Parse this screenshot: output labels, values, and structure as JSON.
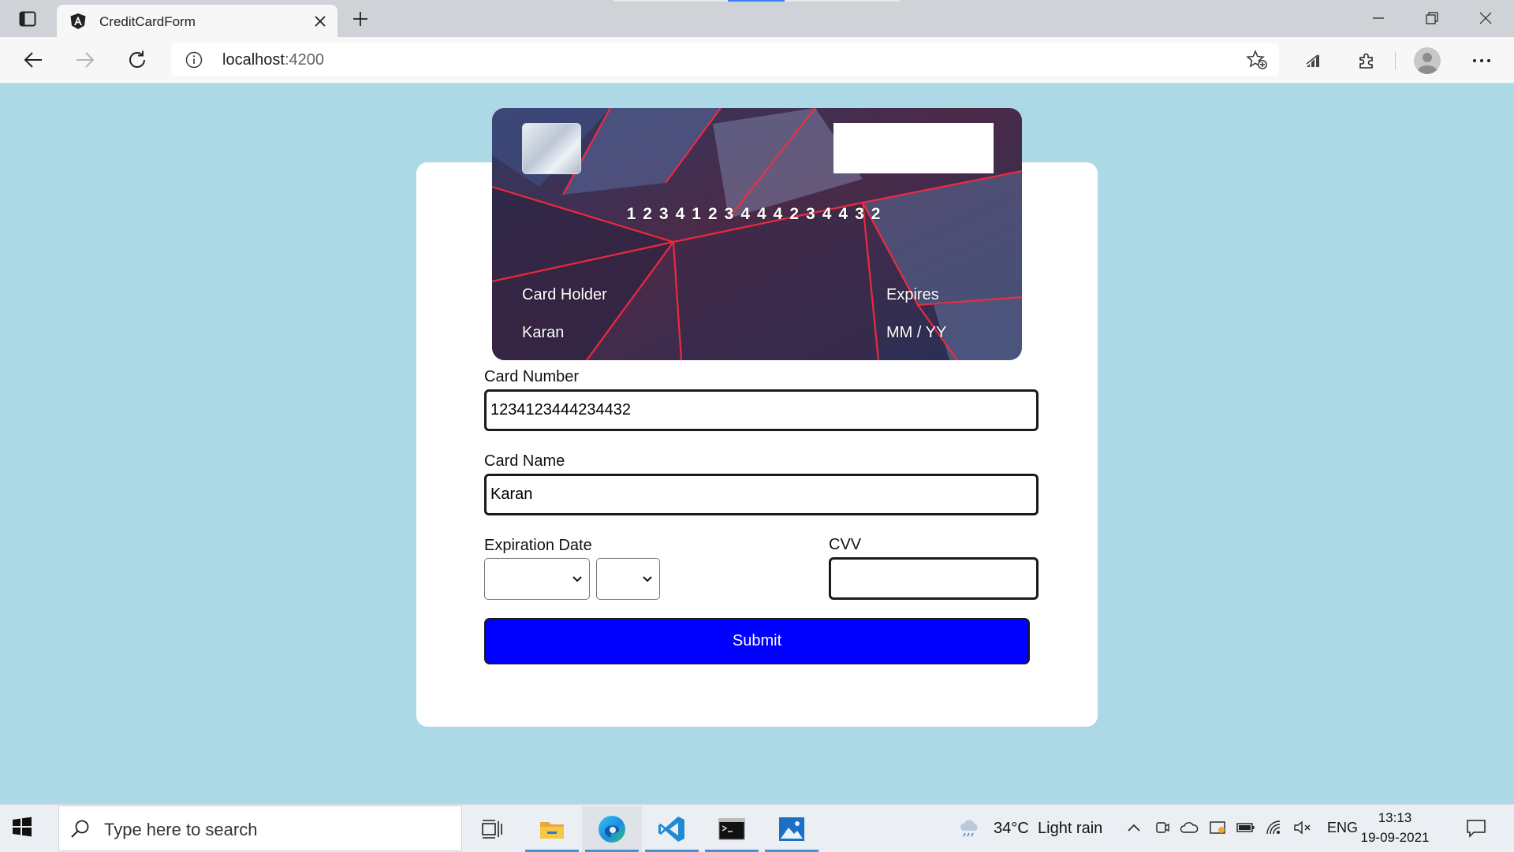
{
  "browser": {
    "tab_title": "CreditCardForm",
    "url_host": "localhost",
    "url_port": ":4200"
  },
  "card_preview": {
    "number": "1234123444234432",
    "holder_label": "Card Holder",
    "holder_name": "Karan",
    "expires_label": "Expires",
    "expires_value": "MM / YY"
  },
  "form": {
    "card_number_label": "Card Number",
    "card_number_value": "1234123444234432",
    "card_name_label": "Card Name",
    "card_name_value": "Karan",
    "expiration_label": "Expiration Date",
    "cvv_label": "CVV",
    "cvv_value": "",
    "submit_label": "Submit"
  },
  "taskbar": {
    "search_placeholder": "Type here to search",
    "weather": "34°C",
    "weather_desc": "Light rain",
    "language": "ENG",
    "time": "13:13",
    "date": "19-09-2021"
  },
  "colors": {
    "page_background": "#add8e6",
    "submit_button": "#0000ff",
    "taskbar_indicator": "#4a8fd8"
  }
}
